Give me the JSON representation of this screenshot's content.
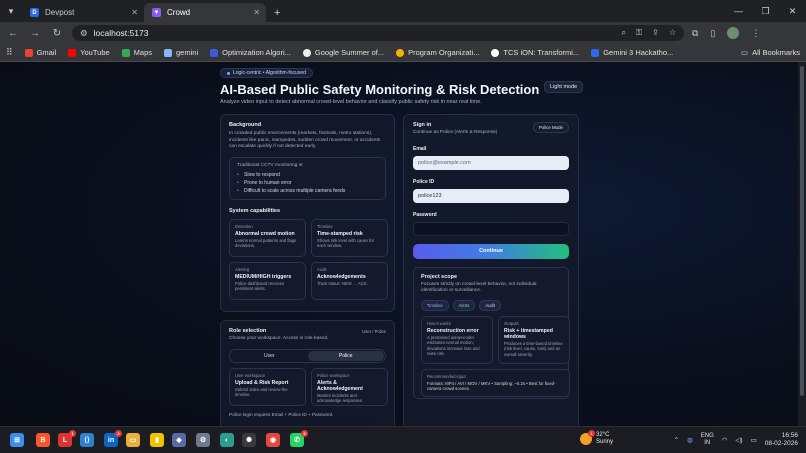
{
  "browser": {
    "tabs": [
      {
        "label": "Devpost",
        "fav": "D",
        "color": "#2d6ae3",
        "active": false
      },
      {
        "label": "Crowd",
        "fav": "▼",
        "color": "#8a5cf6",
        "active": true
      }
    ],
    "new_tab": "+",
    "url": "localhost:5173",
    "bookmarks": [
      {
        "label": "Gmail",
        "color": "#ea4335"
      },
      {
        "label": "YouTube",
        "color": "#ff0000"
      },
      {
        "label": "Maps",
        "color": "#34a853"
      },
      {
        "label": "gemini",
        "color": "#8ab4f8"
      },
      {
        "label": "Optimization Algori...",
        "color": "#3b5bdb"
      },
      {
        "label": "Google Summer of...",
        "color": "#eeeeee"
      },
      {
        "label": "Program Organizati...",
        "color": "#f4b400"
      },
      {
        "label": "TCS iON: Transformi...",
        "color": "#ffffff"
      },
      {
        "label": "Gemini 3 Hackatho...",
        "color": "#2d6ae3"
      }
    ],
    "all_bookmarks": "All Bookmarks"
  },
  "header": {
    "pill": "Logic-centric • Algorithm-focused",
    "title": "AI-Based Public Safety Monitoring & Risk Detection",
    "subtitle": "Analyze video input to detect abnormal crowd-level behavior and classify public safety risk in near real time.",
    "light_mode": "Light mode"
  },
  "background": {
    "heading": "Background",
    "text": "In crowded public environments (markets, festivals, metro stations), incidents like panic, stampedes, sudden crowd movement, or accidents can escalate quickly if not detected early.",
    "cctv_intro": "Traditional CCTV monitoring is:",
    "cctv_items": [
      "Slow to respond",
      "Prone to human error",
      "Difficult to scale across multiple camera feeds"
    ],
    "capabilities_heading": "System capabilities",
    "capabilities": [
      {
        "kicker": "Detection",
        "title": "Abnormal crowd motion",
        "desc": "Learns normal patterns and flags deviations."
      },
      {
        "kicker": "Timeline",
        "title": "Time-stamped risk",
        "desc": "Shows risk level with cause for each window."
      },
      {
        "kicker": "Alerting",
        "title": "MEDIUM/HIGH triggers",
        "desc": "Police dashboard receives persistent alerts."
      },
      {
        "kicker": "Audit",
        "title": "Acknowledgements",
        "desc": "Track status: NEW → ACK."
      }
    ]
  },
  "role": {
    "heading": "Role selection",
    "meta": "User / Police",
    "desc": "Choose your workspace. Access is role-based.",
    "options": [
      "User",
      "Police"
    ],
    "selected": "Police",
    "workspaces": [
      {
        "kicker": "User workspace",
        "title": "Upload & Risk Report",
        "desc": "Submit video and review the timeline."
      },
      {
        "kicker": "Police workspace",
        "title": "Alerts & Acknowledgement",
        "desc": "Monitor incidents and acknowledge responses."
      }
    ],
    "note": "Police login requires Email + Police ID + Password."
  },
  "signin": {
    "heading": "Sign in",
    "sub": "Continue as Police (Alerts & Response)",
    "mode": "Police Mode",
    "email_label": "Email",
    "email_placeholder": "police@example.com",
    "police_id_label": "Police ID",
    "police_id_value": "police123",
    "password_label": "Password",
    "password_value": "",
    "continue": "Continue"
  },
  "scope": {
    "heading": "Project scope",
    "desc": "Focuses strictly on crowd-level behavior, not individual identification or surveillance.",
    "chips": [
      "Timeline",
      "Alerts",
      "Audit"
    ],
    "boxes": [
      {
        "kicker": "How it works",
        "title": "Reconstruction error",
        "desc": "A pretrained autoencoder estimates normal motion; deviations increase loss and raise risk."
      },
      {
        "kicker": "Outputs",
        "title": "Risk + timestamped windows",
        "desc": "Produces a time-based timeline (risk level, cause, loss) and an overall severity."
      }
    ],
    "rec_kicker": "Recommended input",
    "rec_text": "Formats: MP4 / AVI / MOV / MKV • Sampling: ~0.2s • Best for fixed-camera crowd scenes."
  },
  "taskbar": {
    "weather_temp": "32°C",
    "weather_desc": "Sunny",
    "weather_badge": "1",
    "lang1": "ENG",
    "lang2": "IN",
    "time": "16:56",
    "date": "08-02-2026",
    "apps": [
      {
        "name": "start",
        "color": "#3b8eea",
        "glyph": "⊞",
        "badge": ""
      },
      {
        "name": "brave",
        "color": "#fb542b",
        "glyph": "B",
        "badge": ""
      },
      {
        "name": "app-red",
        "color": "#d33",
        "glyph": "L",
        "badge": "1"
      },
      {
        "name": "vscode",
        "color": "#2f80d0",
        "glyph": "⟨⟩",
        "badge": ""
      },
      {
        "name": "linkedin",
        "color": "#0a66c2",
        "glyph": "in",
        "badge": "2"
      },
      {
        "name": "files",
        "color": "#e8b23a",
        "glyph": "▭",
        "badge": ""
      },
      {
        "name": "stats",
        "color": "#f2c200",
        "glyph": "▮",
        "badge": ""
      },
      {
        "name": "shield",
        "color": "#5a6aa8",
        "glyph": "◆",
        "badge": ""
      },
      {
        "name": "settings",
        "color": "#6d7a8c",
        "glyph": "⚙",
        "badge": ""
      },
      {
        "name": "copilot",
        "color": "#2a9d8f",
        "glyph": "◐",
        "badge": ""
      },
      {
        "name": "chatgpt",
        "color": "#3a3a3a",
        "glyph": "✺",
        "badge": ""
      },
      {
        "name": "chrome",
        "color": "#e8453c",
        "glyph": "◉",
        "badge": ""
      },
      {
        "name": "whatsapp",
        "color": "#25d366",
        "glyph": "✆",
        "badge": "9"
      }
    ]
  }
}
